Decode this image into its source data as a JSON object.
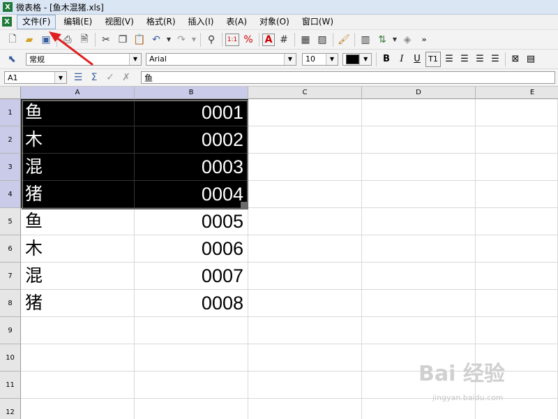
{
  "window": {
    "title": "微表格 - [鱼木混猪.xls]",
    "app_icon": "X"
  },
  "menu": [
    {
      "label": "文件(F)"
    },
    {
      "label": "编辑(E)"
    },
    {
      "label": "视图(V)"
    },
    {
      "label": "格式(R)"
    },
    {
      "label": "插入(I)"
    },
    {
      "label": "表(A)"
    },
    {
      "label": "对象(O)"
    },
    {
      "label": "窗口(W)"
    }
  ],
  "toolbar_icons": [
    "new-file-icon",
    "open-folder-icon",
    "save-icon",
    "print-icon",
    "print-preview-icon",
    "cut-icon",
    "copy-icon",
    "paste-icon",
    "undo-icon",
    "redo-icon",
    "find-icon",
    "number-format-icon",
    "percent-icon",
    "font-color-icon",
    "borders-icon",
    "grid-icon",
    "pattern-icon",
    "clear-format-icon",
    "column-icon",
    "sort-icon",
    "object-icon"
  ],
  "format_bar": {
    "style": "常规",
    "font": "Arial",
    "size": "10",
    "color": "#000000"
  },
  "formula_bar": {
    "cell_ref": "A1",
    "content": "鱼"
  },
  "columns": [
    "A",
    "B",
    "C",
    "D",
    "E"
  ],
  "rows": [
    "1",
    "2",
    "3",
    "4",
    "5",
    "6",
    "7",
    "8",
    "9",
    "10",
    "11",
    "12"
  ],
  "cells": {
    "A": [
      "鱼",
      "木",
      "混",
      "猪",
      "鱼",
      "木",
      "混",
      "猪"
    ],
    "B": [
      "0001",
      "0002",
      "0003",
      "0004",
      "0005",
      "0006",
      "0007",
      "0008"
    ]
  },
  "selection": {
    "range": "A1:B4",
    "fill": "#000000",
    "text": "#ffffff"
  },
  "watermark": {
    "text": "Bai 经验",
    "sub": "jingyan.baidu.com"
  },
  "annotation": {
    "arrow_color": "#e02020"
  }
}
